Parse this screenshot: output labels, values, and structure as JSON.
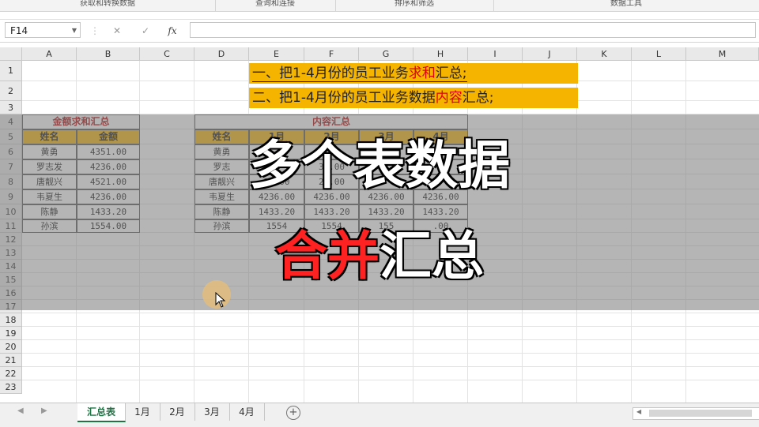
{
  "ribbon": {
    "groups": [
      "获取和转换数据",
      "查询和连接",
      "排序和筛选",
      "数据工具"
    ]
  },
  "formula_bar": {
    "cell_ref": "F14",
    "cancel_icon": "✕",
    "enter_icon": "✓",
    "fx_label": "fx",
    "value": ""
  },
  "columns": [
    "A",
    "B",
    "C",
    "D",
    "E",
    "F",
    "G",
    "H",
    "I",
    "J",
    "K",
    "L",
    "M"
  ],
  "rows": [
    "1",
    "2",
    "3",
    "4",
    "5",
    "6",
    "7",
    "8",
    "9",
    "10",
    "11",
    "12",
    "13",
    "14",
    "15",
    "16",
    "17",
    "18",
    "19",
    "20",
    "21",
    "22",
    "23"
  ],
  "instructions": {
    "line1": {
      "prefix": "一、把1-4月份的员工业务",
      "highlight": "求和",
      "suffix": "汇总;"
    },
    "line2": {
      "prefix": "二、把1-4月份的员工业务数据",
      "highlight": "内容",
      "suffix": "汇总;"
    }
  },
  "sum_table": {
    "title": "金额求和汇总",
    "headers": [
      "姓名",
      "金额"
    ],
    "rows": [
      [
        "黄勇",
        "4351.00"
      ],
      [
        "罗志发",
        "4236.00"
      ],
      [
        "唐靓兴",
        "4521.00"
      ],
      [
        "韦夏生",
        "4236.00"
      ],
      [
        "陈静",
        "1433.20"
      ],
      [
        "孙滨",
        "1554.00"
      ]
    ]
  },
  "content_table": {
    "title": "内容汇总",
    "headers": [
      "姓名",
      "1月",
      "2月",
      "3月",
      "4月"
    ],
    "rows": [
      [
        "黄勇",
        "",
        "",
        "",
        ""
      ],
      [
        "罗志",
        "",
        "36.00",
        "",
        ""
      ],
      [
        "唐靓兴",
        "21.00",
        "21.00",
        "",
        ""
      ],
      [
        "韦夏生",
        "4236.00",
        "4236.00",
        "4236.00",
        "4236.00"
      ],
      [
        "陈静",
        "1433.20",
        "1433.20",
        "1433.20",
        "1433.20"
      ],
      [
        "孙滨",
        "1554",
        "1554",
        "155",
        ".00"
      ]
    ]
  },
  "overlay": {
    "line1": "多个表数据",
    "line2_red": "合并",
    "line2_white": "汇总"
  },
  "sheet_tabs": [
    "汇总表",
    "1月",
    "2月",
    "3月",
    "4月"
  ],
  "add_sheet_icon": "+",
  "colors": {
    "accent_yellow": "#f5b400",
    "title_red": "#b00000",
    "excel_green": "#217346"
  }
}
